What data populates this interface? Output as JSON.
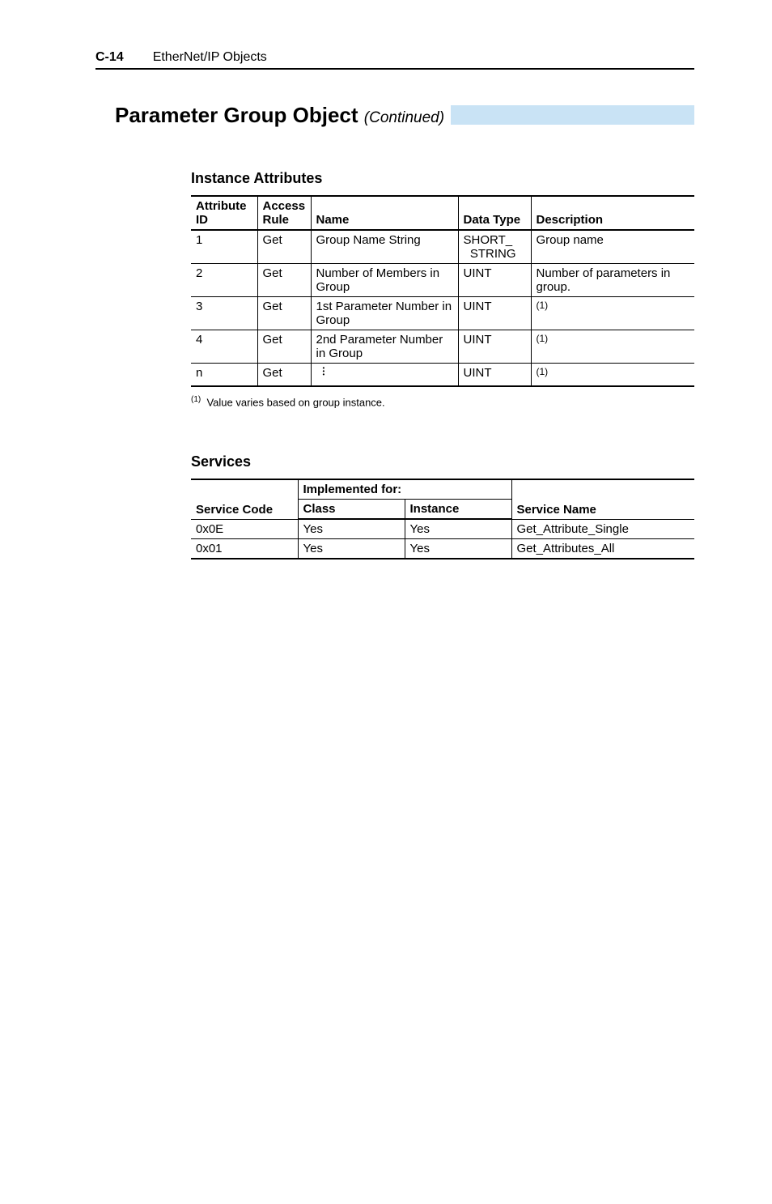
{
  "header": {
    "page_no": "C-14",
    "section": "EtherNet/IP Objects"
  },
  "section_title": {
    "main": "Parameter Group Object",
    "suffix": "(Continued)"
  },
  "instance_attributes": {
    "heading": "Instance Attributes",
    "columns": {
      "attr_id": "Attribute ID",
      "access_rule": "Access Rule",
      "name": "Name",
      "data_type": "Data Type",
      "description": "Description"
    },
    "rows": [
      {
        "id": "1",
        "rule": "Get",
        "name": "Group Name String",
        "type": "SHORT_\nSTRING",
        "desc": "Group name"
      },
      {
        "id": "2",
        "rule": "Get",
        "name": "Number of Members in Group",
        "type": "UINT",
        "desc": "Number of parameters in group."
      },
      {
        "id": "3",
        "rule": "Get",
        "name": "1st Parameter Number in Group",
        "type": "UINT",
        "desc": "(1)"
      },
      {
        "id": "4",
        "rule": "Get",
        "name": "2nd Parameter Number in Group",
        "type": "UINT",
        "desc": "(1)"
      },
      {
        "id": "n",
        "rule": "Get",
        "name": "⋮",
        "type": "UINT",
        "desc": "(1)"
      }
    ],
    "footnote_marker": "(1)",
    "footnote_text": "Value varies based on group instance."
  },
  "services": {
    "heading": "Services",
    "columns": {
      "impl_for": "Implemented for:",
      "service_code": "Service Code",
      "class": "Class",
      "instance": "Instance",
      "service_name": "Service Name"
    },
    "rows": [
      {
        "code": "0x0E",
        "class": "Yes",
        "instance": "Yes",
        "name": "Get_Attribute_Single"
      },
      {
        "code": "0x01",
        "class": "Yes",
        "instance": "Yes",
        "name": "Get_Attributes_All"
      }
    ]
  }
}
